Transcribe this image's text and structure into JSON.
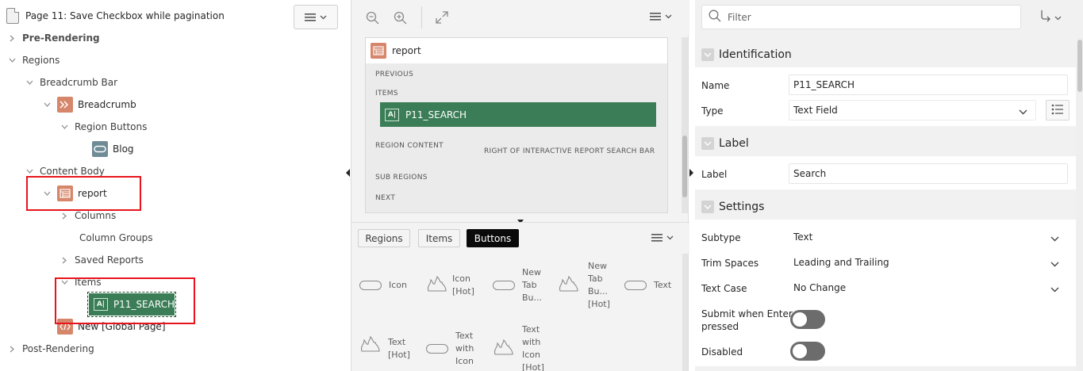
{
  "tree": {
    "page_title": "Page 11: Save Checkbox while pagination",
    "nodes": {
      "pre_rendering": "Pre-Rendering",
      "regions": "Regions",
      "breadcrumb_bar": "Breadcrumb Bar",
      "breadcrumb": "Breadcrumb",
      "region_buttons": "Region Buttons",
      "blog": "Blog",
      "content_body": "Content Body",
      "report": "report",
      "columns": "Columns",
      "column_groups": "Column Groups",
      "saved_reports": "Saved Reports",
      "items": "Items",
      "p11_search": "P11_SEARCH",
      "new_global_page": "New [Global Page]",
      "post_rendering": "Post-Rendering"
    },
    "item_icon_text": "A|"
  },
  "layout": {
    "region_title": "report",
    "labels": {
      "previous": "PREVIOUS",
      "items": "ITEMS",
      "region_content": "REGION CONTENT",
      "right_of_search": "RIGHT OF INTERACTIVE REPORT SEARCH BAR",
      "sub_regions": "SUB REGIONS",
      "next": "NEXT"
    },
    "item": "P11_SEARCH",
    "item_icon_text": "A|"
  },
  "gallery": {
    "tabs": [
      "Regions",
      "Items",
      "Buttons"
    ],
    "active_tab": "Buttons",
    "cells": [
      {
        "lines": [
          "Icon"
        ]
      },
      {
        "lines": [
          "Icon",
          "[Hot]"
        ]
      },
      {
        "lines": [
          "New",
          "Tab",
          "Bu..."
        ]
      },
      {
        "lines": [
          "New",
          "Tab",
          "Bu...",
          "[Hot]"
        ]
      },
      {
        "lines": [
          "Text"
        ]
      },
      {
        "lines": [
          "Text",
          "[Hot]"
        ]
      },
      {
        "lines": [
          "Text",
          "with",
          "Icon"
        ]
      },
      {
        "lines": [
          "Text",
          "with",
          "Icon",
          "[Hot]"
        ]
      }
    ]
  },
  "properties": {
    "filter_placeholder": "Filter",
    "sections": {
      "identification": "Identification",
      "label": "Label",
      "settings": "Settings"
    },
    "name": {
      "label": "Name",
      "value": "P11_SEARCH"
    },
    "type": {
      "label": "Type",
      "value": "Text Field"
    },
    "label_prop": {
      "label": "Label",
      "value": "Search"
    },
    "subtype": {
      "label": "Subtype",
      "value": "Text"
    },
    "trim_spaces": {
      "label": "Trim Spaces",
      "value": "Leading and Trailing"
    },
    "text_case": {
      "label": "Text Case",
      "value": "No Change"
    },
    "submit_when_enter": {
      "label_line1": "Submit when Enter",
      "label_line2": "pressed",
      "on": false
    },
    "disabled": {
      "label": "Disabled",
      "on": false
    }
  },
  "colors": {
    "selected_item": "#3a7d56",
    "highlight_border": "#e8141b",
    "region_icon": "#d6866a",
    "button_icon": "#6f8c96"
  }
}
